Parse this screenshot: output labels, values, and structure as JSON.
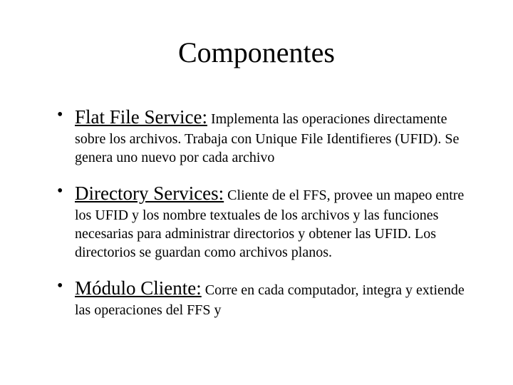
{
  "title": "Componentes",
  "items": [
    {
      "heading": "Flat File Service:",
      "body": " Implementa las operaciones directamente sobre los archivos. Trabaja con Unique File Identifieres (UFID). Se genera uno nuevo por cada archivo"
    },
    {
      "heading": "Directory Services:",
      "body": " Cliente de el FFS, provee un mapeo entre los UFID y los nombre textuales de los archivos y las funciones necesarias para administrar directorios y obtener las UFID. Los directorios se guardan como archivos planos."
    },
    {
      "heading": "Módulo Cliente:",
      "body": " Corre en cada computador, integra y extiende las operaciones del FFS y"
    }
  ]
}
